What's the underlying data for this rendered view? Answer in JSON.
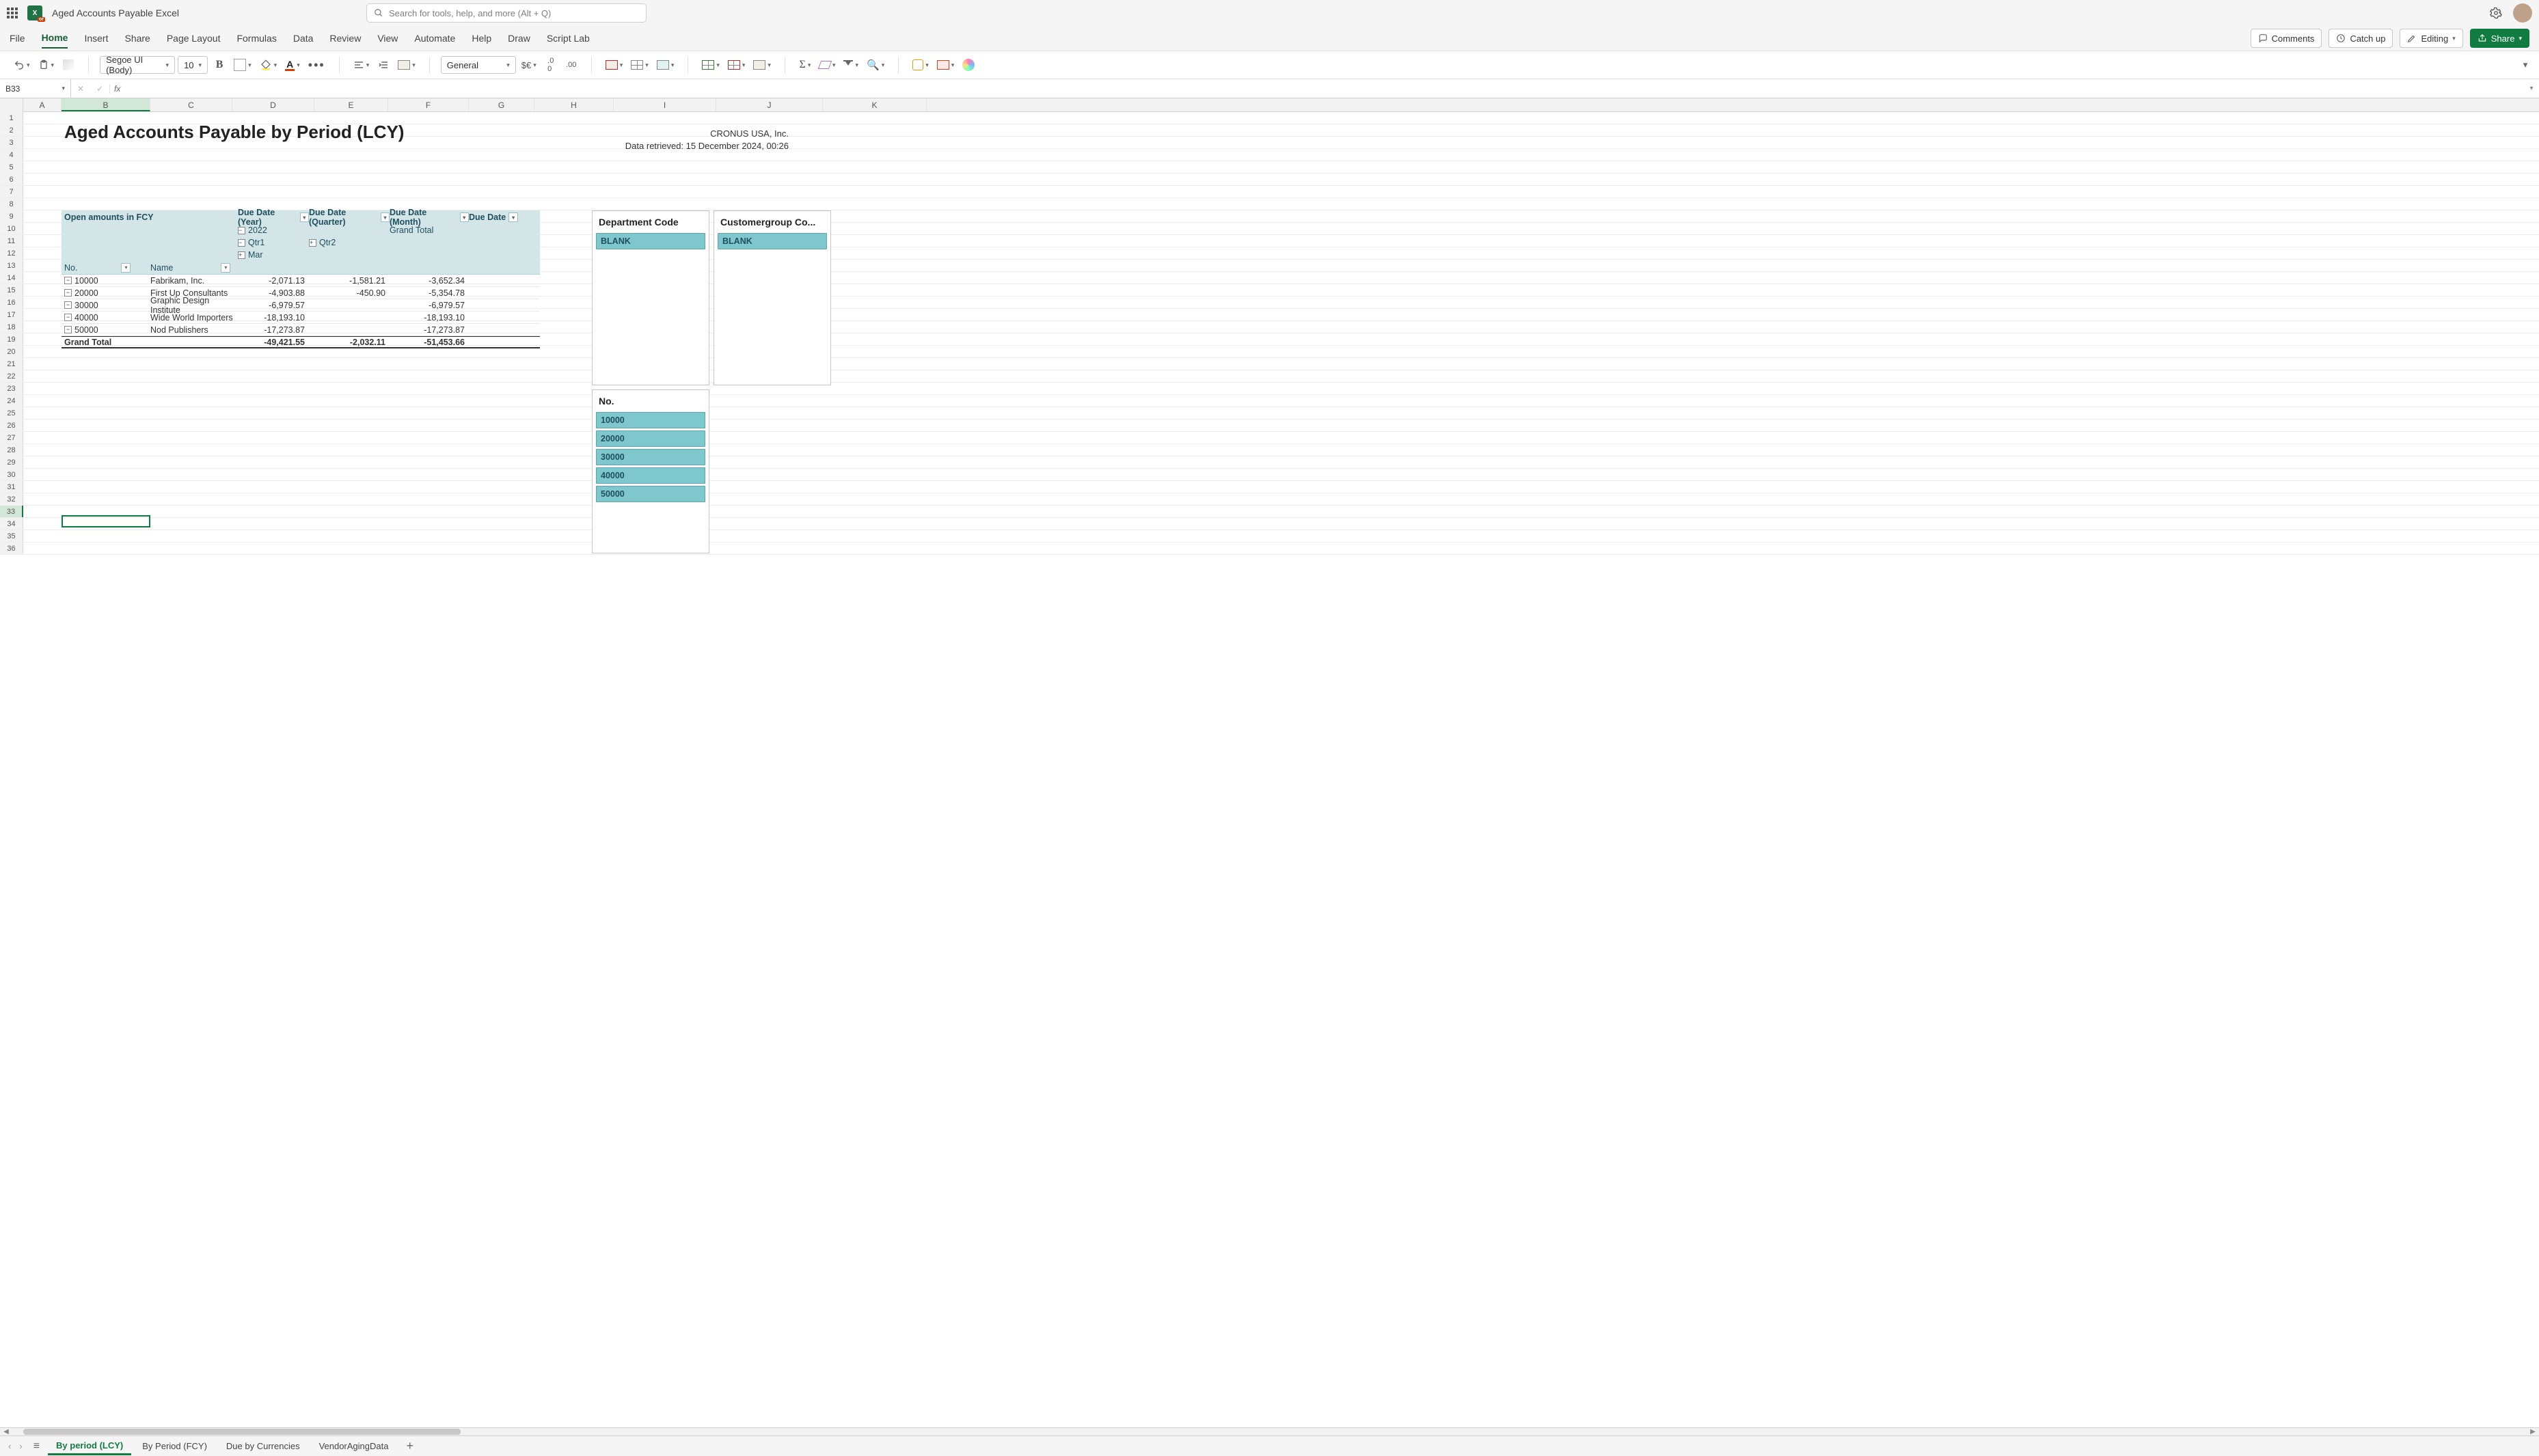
{
  "app": {
    "doc_title": "Aged Accounts Payable Excel",
    "search_placeholder": "Search for tools, help, and more (Alt + Q)"
  },
  "ribbon": {
    "tabs": [
      "File",
      "Home",
      "Insert",
      "Share",
      "Page Layout",
      "Formulas",
      "Data",
      "Review",
      "View",
      "Automate",
      "Help",
      "Draw",
      "Script Lab"
    ],
    "active": "Home",
    "comments": "Comments",
    "catch_up": "Catch up",
    "editing": "Editing",
    "share": "Share"
  },
  "toolbar": {
    "font": "Segoe UI (Body)",
    "size": "10",
    "numfmt": "General"
  },
  "formula_bar": {
    "name_box": "B33",
    "fx": "fx"
  },
  "columns": [
    "A",
    "B",
    "C",
    "D",
    "E",
    "F",
    "G",
    "H",
    "I",
    "J",
    "K"
  ],
  "report": {
    "title": "Aged Accounts Payable by Period (LCY)",
    "company": "CRONUS USA, Inc.",
    "retrieved": "Data retrieved: 15 December 2024, 00:26"
  },
  "pivot": {
    "open_label": "Open amounts in FCY",
    "year_label": "Due Date (Year)",
    "quarter_label": "Due Date (Quarter)",
    "month_label": "Due Date (Month)",
    "due_label": "Due Date",
    "year": "2022",
    "grand_total_col": "Grand Total",
    "qtr1": "Qtr1",
    "qtr2": "Qtr2",
    "mar": "Mar",
    "no_label": "No.",
    "name_label": "Name",
    "rows": [
      {
        "no": "10000",
        "name": "Fabrikam, Inc.",
        "q1": "-2,071.13",
        "q2": "-1,581.21",
        "gt": "-3,652.34"
      },
      {
        "no": "20000",
        "name": "First Up Consultants",
        "q1": "-4,903.88",
        "q2": "-450.90",
        "gt": "-5,354.78"
      },
      {
        "no": "30000",
        "name": "Graphic Design Institute",
        "q1": "-6,979.57",
        "q2": "",
        "gt": "-6,979.57"
      },
      {
        "no": "40000",
        "name": "Wide World Importers",
        "q1": "-18,193.10",
        "q2": "",
        "gt": "-18,193.10"
      },
      {
        "no": "50000",
        "name": "Nod Publishers",
        "q1": "-17,273.87",
        "q2": "",
        "gt": "-17,273.87"
      }
    ],
    "grand_total_label": "Grand Total",
    "grand_total": {
      "q1": "-49,421.55",
      "q2": "-2,032.11",
      "gt": "-51,453.66"
    }
  },
  "slicers": {
    "department": {
      "title": "Department Code",
      "items": [
        "BLANK"
      ]
    },
    "customergroup": {
      "title": "Customergroup Co...",
      "items": [
        "BLANK"
      ]
    },
    "no": {
      "title": "No.",
      "items": [
        "10000",
        "20000",
        "30000",
        "40000",
        "50000"
      ]
    }
  },
  "sheets": {
    "tabs": [
      "By period (LCY)",
      "By Period (FCY)",
      "Due by Currencies",
      "VendorAgingData"
    ],
    "active": "By period (LCY)"
  }
}
